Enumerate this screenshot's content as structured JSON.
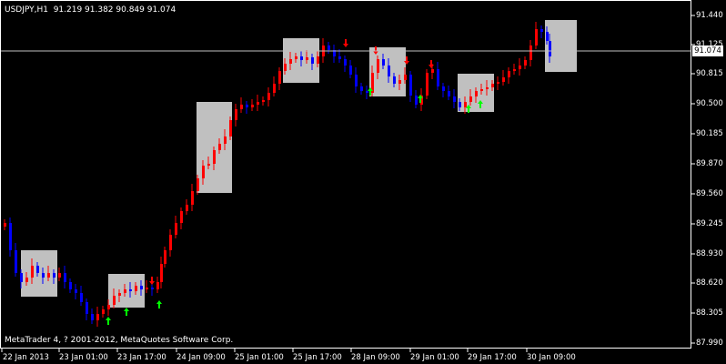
{
  "header": {
    "symbol_label": "USDJPY,H1  91.219 91.382 90.849 91.074"
  },
  "footer": {
    "copyright": "MetaTrader 4, ? 2001-2012, MetaQuotes Software Corp."
  },
  "current_price": "91.074",
  "colors": {
    "background": "#000000",
    "bull": "#ff0000",
    "bear": "#0000ff",
    "box": "#c0c0c0",
    "up_arrow": "#00ff00",
    "down_arrow": "#ff0000",
    "axis": "#ffffff",
    "price_line": "#c0c0c0"
  },
  "y_axis": {
    "labels": [
      "91.440",
      "91.125",
      "90.815",
      "90.500",
      "90.185",
      "89.870",
      "89.560",
      "89.245",
      "88.930",
      "88.620",
      "88.305",
      "87.990"
    ]
  },
  "x_axis": {
    "labels": [
      "22 Jan 2013",
      "23 Jan 01:00",
      "23 Jan 17:00",
      "24 Jan 09:00",
      "25 Jan 01:00",
      "25 Jan 17:00",
      "28 Jan 09:00",
      "29 Jan 01:00",
      "29 Jan 17:00",
      "30 Jan 09:00"
    ]
  }
}
